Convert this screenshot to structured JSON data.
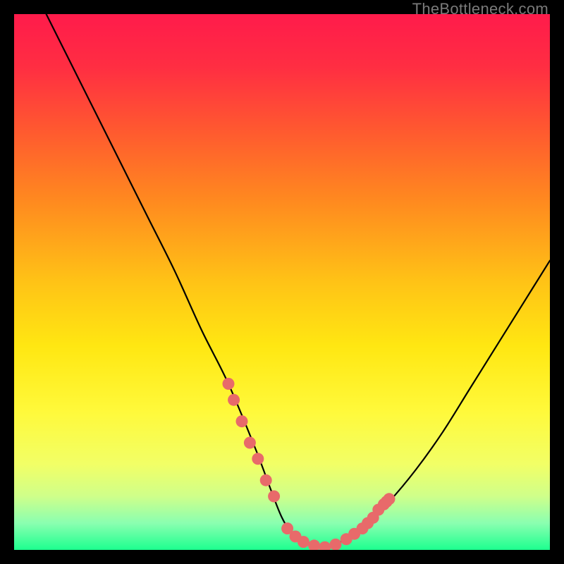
{
  "watermark": "TheBottleneck.com",
  "gradient": {
    "stops": [
      {
        "offset": 0.0,
        "color": "#ff1b4b"
      },
      {
        "offset": 0.1,
        "color": "#ff2e42"
      },
      {
        "offset": 0.22,
        "color": "#ff5a2f"
      },
      {
        "offset": 0.35,
        "color": "#ff8a1f"
      },
      {
        "offset": 0.5,
        "color": "#ffc316"
      },
      {
        "offset": 0.62,
        "color": "#ffe712"
      },
      {
        "offset": 0.74,
        "color": "#fff93a"
      },
      {
        "offset": 0.84,
        "color": "#f2ff66"
      },
      {
        "offset": 0.9,
        "color": "#cfff8a"
      },
      {
        "offset": 0.95,
        "color": "#8affb0"
      },
      {
        "offset": 1.0,
        "color": "#1dff8f"
      }
    ]
  },
  "chart_data": {
    "type": "line",
    "title": "",
    "xlabel": "",
    "ylabel": "",
    "xlim": [
      0,
      100
    ],
    "ylim": [
      0,
      100
    ],
    "series": [
      {
        "name": "bottleneck-curve",
        "x": [
          6,
          10,
          15,
          20,
          25,
          30,
          35,
          40,
          45,
          48,
          50,
          52,
          55,
          58,
          60,
          65,
          70,
          75,
          80,
          85,
          90,
          95,
          100
        ],
        "y": [
          100,
          92,
          82,
          72,
          62,
          52,
          41,
          31,
          19,
          11,
          6,
          3,
          1,
          0.5,
          1,
          4,
          9,
          15,
          22,
          30,
          38,
          46,
          54
        ]
      }
    ],
    "highlight_points": {
      "name": "markers",
      "color": "#e86a6a",
      "left_cluster_x": [
        40,
        41,
        42.5,
        44,
        45.5,
        47,
        48.5
      ],
      "left_cluster_y": [
        31,
        28,
        24,
        20,
        17,
        13,
        10
      ],
      "bottom_cluster_x": [
        51,
        52.5,
        54,
        56,
        58,
        60,
        62,
        63.5,
        65
      ],
      "bottom_cluster_y": [
        4,
        2.5,
        1.5,
        0.8,
        0.5,
        1,
        2,
        3,
        4
      ],
      "right_cluster_x": [
        66,
        67,
        68,
        69,
        69.5,
        70
      ],
      "right_cluster_y": [
        5,
        6,
        7.5,
        8.5,
        9,
        9.5
      ]
    }
  }
}
